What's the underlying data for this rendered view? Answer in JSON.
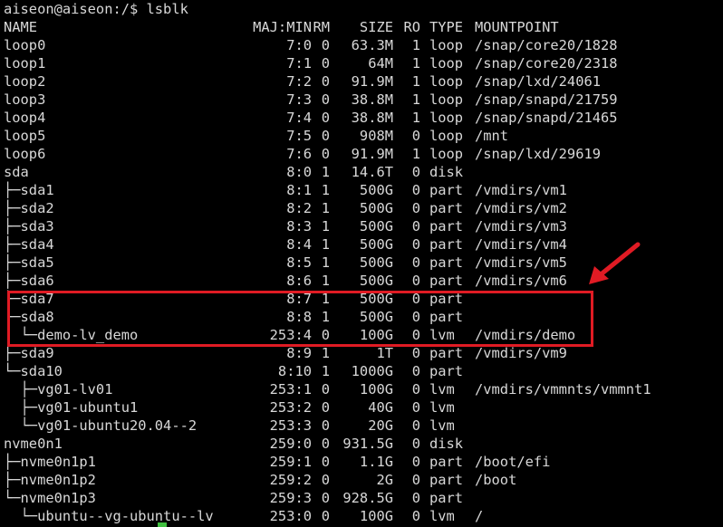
{
  "prompt": "aiseon@aiseon:/$ lsblk",
  "header": {
    "name": "NAME",
    "majmin": "MAJ:MIN",
    "rm": "RM",
    "size": "SIZE",
    "ro": "RO",
    "type": "TYPE",
    "mountpoint": "MOUNTPOINT"
  },
  "rows": [
    {
      "name": "loop0",
      "majmin": "7:0",
      "rm": "0",
      "size": "63.3M",
      "ro": "1",
      "type": "loop",
      "mountpoint": "/snap/core20/1828"
    },
    {
      "name": "loop1",
      "majmin": "7:1",
      "rm": "0",
      "size": "64M",
      "ro": "1",
      "type": "loop",
      "mountpoint": "/snap/core20/2318"
    },
    {
      "name": "loop2",
      "majmin": "7:2",
      "rm": "0",
      "size": "91.9M",
      "ro": "1",
      "type": "loop",
      "mountpoint": "/snap/lxd/24061"
    },
    {
      "name": "loop3",
      "majmin": "7:3",
      "rm": "0",
      "size": "38.8M",
      "ro": "1",
      "type": "loop",
      "mountpoint": "/snap/snapd/21759"
    },
    {
      "name": "loop4",
      "majmin": "7:4",
      "rm": "0",
      "size": "38.8M",
      "ro": "1",
      "type": "loop",
      "mountpoint": "/snap/snapd/21465"
    },
    {
      "name": "loop5",
      "majmin": "7:5",
      "rm": "0",
      "size": "908M",
      "ro": "0",
      "type": "loop",
      "mountpoint": "/mnt"
    },
    {
      "name": "loop6",
      "majmin": "7:6",
      "rm": "0",
      "size": "91.9M",
      "ro": "1",
      "type": "loop",
      "mountpoint": "/snap/lxd/29619"
    },
    {
      "name": "sda",
      "majmin": "8:0",
      "rm": "1",
      "size": "14.6T",
      "ro": "0",
      "type": "disk",
      "mountpoint": ""
    },
    {
      "name": "├─sda1",
      "majmin": "8:1",
      "rm": "1",
      "size": "500G",
      "ro": "0",
      "type": "part",
      "mountpoint": "/vmdirs/vm1"
    },
    {
      "name": "├─sda2",
      "majmin": "8:2",
      "rm": "1",
      "size": "500G",
      "ro": "0",
      "type": "part",
      "mountpoint": "/vmdirs/vm2"
    },
    {
      "name": "├─sda3",
      "majmin": "8:3",
      "rm": "1",
      "size": "500G",
      "ro": "0",
      "type": "part",
      "mountpoint": "/vmdirs/vm3"
    },
    {
      "name": "├─sda4",
      "majmin": "8:4",
      "rm": "1",
      "size": "500G",
      "ro": "0",
      "type": "part",
      "mountpoint": "/vmdirs/vm4"
    },
    {
      "name": "├─sda5",
      "majmin": "8:5",
      "rm": "1",
      "size": "500G",
      "ro": "0",
      "type": "part",
      "mountpoint": "/vmdirs/vm5"
    },
    {
      "name": "├─sda6",
      "majmin": "8:6",
      "rm": "1",
      "size": "500G",
      "ro": "0",
      "type": "part",
      "mountpoint": "/vmdirs/vm6"
    },
    {
      "name": "├─sda7",
      "majmin": "8:7",
      "rm": "1",
      "size": "500G",
      "ro": "0",
      "type": "part",
      "mountpoint": ""
    },
    {
      "name": "├─sda8",
      "majmin": "8:8",
      "rm": "1",
      "size": "500G",
      "ro": "0",
      "type": "part",
      "mountpoint": ""
    },
    {
      "name": "│ └─demo-lv_demo",
      "majmin": "253:4",
      "rm": "0",
      "size": "100G",
      "ro": "0",
      "type": "lvm",
      "mountpoint": "/vmdirs/demo"
    },
    {
      "name": "├─sda9",
      "majmin": "8:9",
      "rm": "1",
      "size": "1T",
      "ro": "0",
      "type": "part",
      "mountpoint": "/vmdirs/vm9"
    },
    {
      "name": "└─sda10",
      "majmin": "8:10",
      "rm": "1",
      "size": "1000G",
      "ro": "0",
      "type": "part",
      "mountpoint": ""
    },
    {
      "name": "  ├─vg01-lv01",
      "majmin": "253:1",
      "rm": "0",
      "size": "100G",
      "ro": "0",
      "type": "lvm",
      "mountpoint": "/vmdirs/vmmnts/vmmnt1"
    },
    {
      "name": "  ├─vg01-ubuntu1",
      "majmin": "253:2",
      "rm": "0",
      "size": "40G",
      "ro": "0",
      "type": "lvm",
      "mountpoint": ""
    },
    {
      "name": "  └─vg01-ubuntu20.04--2",
      "majmin": "253:3",
      "rm": "0",
      "size": "20G",
      "ro": "0",
      "type": "lvm",
      "mountpoint": ""
    },
    {
      "name": "nvme0n1",
      "majmin": "259:0",
      "rm": "0",
      "size": "931.5G",
      "ro": "0",
      "type": "disk",
      "mountpoint": ""
    },
    {
      "name": "├─nvme0n1p1",
      "majmin": "259:1",
      "rm": "0",
      "size": "1.1G",
      "ro": "0",
      "type": "part",
      "mountpoint": "/boot/efi"
    },
    {
      "name": "├─nvme0n1p2",
      "majmin": "259:2",
      "rm": "0",
      "size": "2G",
      "ro": "0",
      "type": "part",
      "mountpoint": "/boot"
    },
    {
      "name": "└─nvme0n1p3",
      "majmin": "259:3",
      "rm": "0",
      "size": "928.5G",
      "ro": "0",
      "type": "part",
      "mountpoint": ""
    },
    {
      "name": "  └─ubuntu--vg-ubuntu--lv",
      "majmin": "253:0",
      "rm": "0",
      "size": "100G",
      "ro": "0",
      "type": "lvm",
      "mountpoint": "/"
    }
  ],
  "colors": {
    "background": "#000000",
    "text": "#d8d8d8",
    "highlight": "#e01b24",
    "cursor": "#3fbf3f"
  }
}
